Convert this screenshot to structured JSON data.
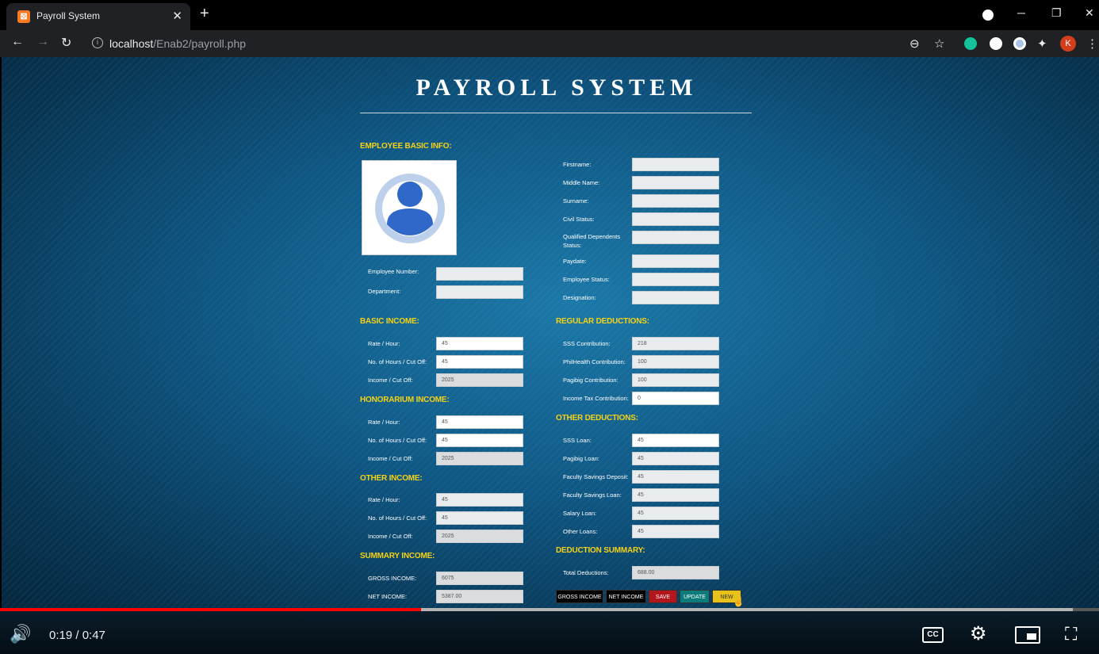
{
  "browser": {
    "tab_title": "Payroll System",
    "url_host": "localhost",
    "url_path": "/Enab2/payroll.php",
    "avatar_letter": "K"
  },
  "page": {
    "title": "PAYROLL SYSTEM",
    "sections": {
      "basic_info": "EMPLOYEE BASIC INFO:",
      "basic_income": "BASIC INCOME:",
      "honorarium_income": "HONORARIUM INCOME:",
      "other_income": "OTHER INCOME:",
      "summary_income": "SUMMARY INCOME:",
      "regular_deductions": "REGULAR DEDUCTIONS:",
      "other_deductions": "OTHER DEDUCTIONS:",
      "deduction_summary": "DEDUCTION SUMMARY:"
    },
    "employee_left": [
      {
        "label": "Employee Number:",
        "value": ""
      },
      {
        "label": "Department:",
        "value": ""
      }
    ],
    "employee_right": [
      {
        "label": "Firstname:",
        "value": ""
      },
      {
        "label": "Middle Name:",
        "value": ""
      },
      {
        "label": "Surname:",
        "value": ""
      },
      {
        "label": "Civil Status:",
        "value": ""
      },
      {
        "label": "Qualified Dependents Status:",
        "value": ""
      },
      {
        "label": "Paydate:",
        "value": ""
      },
      {
        "label": "Employee Status:",
        "value": ""
      },
      {
        "label": "Designation:",
        "value": ""
      }
    ],
    "basic_income": [
      {
        "label": "Rate / Hour:",
        "value": "45"
      },
      {
        "label": "No. of Hours / Cut Off:",
        "value": "45"
      },
      {
        "label": "Income / Cut Off:",
        "value": "2025"
      }
    ],
    "honorarium_income": [
      {
        "label": "Rate / Hour:",
        "value": "45"
      },
      {
        "label": "No. of Hours / Cut Off:",
        "value": "45"
      },
      {
        "label": "Income / Cut Off:",
        "value": "2025"
      }
    ],
    "other_income": [
      {
        "label": "Rate / Hour:",
        "value": "45"
      },
      {
        "label": "No. of Hours / Cut Off:",
        "value": "45"
      },
      {
        "label": "Income / Cut Off:",
        "value": "2025"
      }
    ],
    "summary_income": [
      {
        "label": "GROSS INCOME:",
        "value": "6075"
      },
      {
        "label": "NET INCOME:",
        "value": "5387.00"
      }
    ],
    "regular_deductions": [
      {
        "label": "SSS Contribution:",
        "value": "218"
      },
      {
        "label": "PhilHealth Contribution:",
        "value": "100"
      },
      {
        "label": "Pagibig Contribution:",
        "value": "100"
      },
      {
        "label": "Income Tax Contribution:",
        "value": "0"
      }
    ],
    "other_deductions": [
      {
        "label": "SSS Loan:",
        "value": "45"
      },
      {
        "label": "Pagibig Loan:",
        "value": "45"
      },
      {
        "label": "Faculty Savings Deposit:",
        "value": "45"
      },
      {
        "label": "Faculty Savings Loan:",
        "value": "45"
      },
      {
        "label": "Salary Loan:",
        "value": "45"
      },
      {
        "label": "Other Loans:",
        "value": "45"
      }
    ],
    "deduction_summary": [
      {
        "label": "Total Deductions:",
        "value": "688.00"
      }
    ],
    "buttons": {
      "gross_income": "GROSS INCOME",
      "net_income": "NET INCOME",
      "save": "SAVE",
      "update": "UPDATE",
      "new": "NEW"
    },
    "colors": {
      "section_heading": "#f5d214",
      "save_button": "#b3161c",
      "update_button": "#0c7b7b",
      "new_button": "#e6c21a"
    }
  },
  "video": {
    "time": "0:19 / 0:47",
    "progress_played": 0.383,
    "progress_buffered": 0.976,
    "cc_label": "CC"
  }
}
